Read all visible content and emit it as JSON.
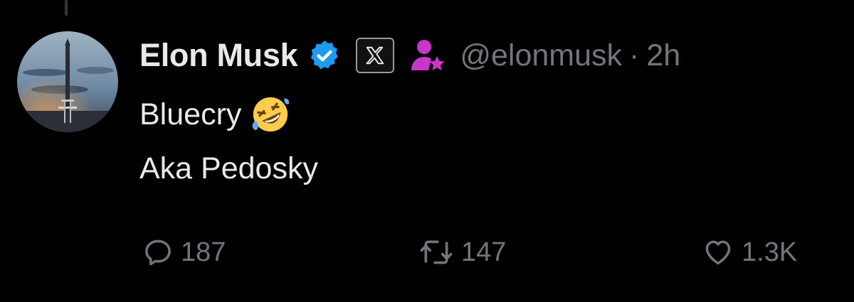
{
  "author": {
    "name": "Elon Musk",
    "handle": "@elonmusk",
    "separator": "·",
    "time": "2h",
    "verified_color": "#1d9bf0",
    "role_icon_color": "#c936c9"
  },
  "tweet": {
    "lines": [
      "Bluecry",
      "Aka Pedosky"
    ],
    "emoji": "rolling-on-floor-laughing"
  },
  "actions": {
    "reply_count": "187",
    "retweet_count": "147",
    "like_count": "1.3K"
  }
}
